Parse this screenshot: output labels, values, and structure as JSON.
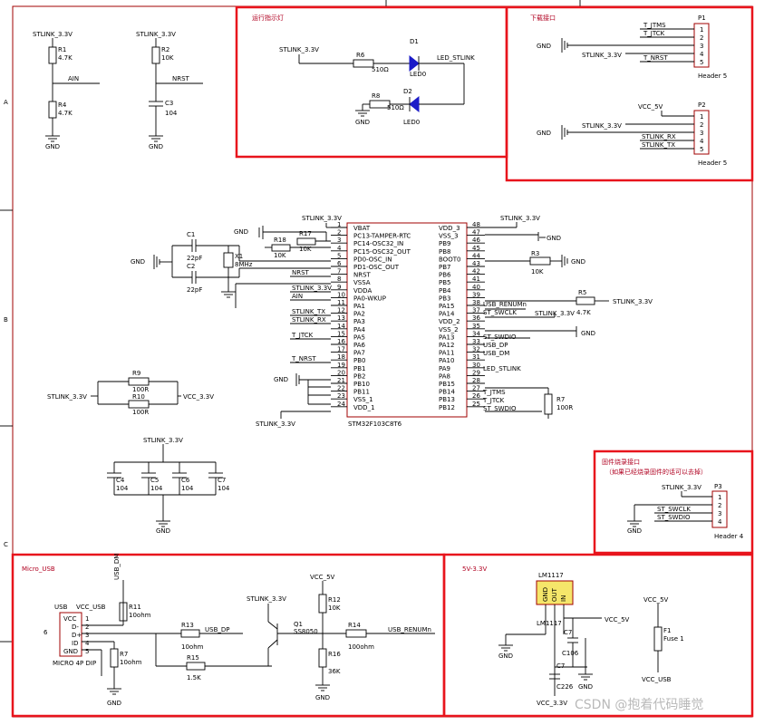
{
  "modules": {
    "led": "运行指示灯",
    "download": "下载接口",
    "firmware": "固件烧录接口",
    "firmware_note": "（如果已经烧录固件的话可以去掉）",
    "usb": "Micro_USB",
    "power": "5V-3.3V"
  },
  "frame": {
    "a": "A",
    "b": "B",
    "c": "C"
  },
  "nets": {
    "stlink33": "STLINK_3.3V",
    "gnd": "GND",
    "ain": "AIN",
    "nrst": "NRST",
    "led_stlink": "LED_STLINK",
    "t_jtms": "T_JTMS",
    "t_jtck": "T_JTCK",
    "t_nrst": "T_NRST",
    "vcc5": "VCC_5V",
    "vcc33": "VCC_3.3V",
    "stlink_rx": "STLINK_RX",
    "stlink_tx": "STLINK_TX",
    "usb_renum": "USB_RENUMn",
    "st_swclk": "ST_SWCLK",
    "st_swdio": "ST_SWDIO",
    "usb_dp": "USB_DP",
    "usb_dm": "USB_DM",
    "vcc_usb": "VCC_USB"
  },
  "parts": {
    "r1": "R1",
    "r1v": "4.7K",
    "r4": "R4",
    "r4v": "4.7K",
    "r2": "R2",
    "r2v": "10K",
    "c3": "C3",
    "c3v": "104",
    "r6": "R6",
    "r6v": "510Ω",
    "d1": "D1",
    "d1v": "LED0",
    "r8": "R8",
    "r8v": "510Ω",
    "d2": "D2",
    "d2v": "LED0",
    "p1": "P1",
    "p1v": "Header 5",
    "p2": "P2",
    "p2v": "Header 5",
    "p3": "P3",
    "p3v": "Header 4",
    "c1": "C1",
    "c1v": "22pF",
    "c2": "C2",
    "c2v": "22pF",
    "x1": "X1",
    "x1v": "8MHz",
    "r18": "R18",
    "r18v": "10K",
    "r17": "R17",
    "r17v": "10K",
    "r3": "R3",
    "r3v": "10K",
    "r5": "R5",
    "r5v": "4.7K",
    "r7": "R7",
    "r7v": "100R",
    "r9": "R9",
    "r9v": "100R",
    "r10": "R10",
    "r10v": "100R",
    "c4": "C4",
    "c5": "C5",
    "c6": "C6",
    "c7": "C7",
    "c104": "104",
    "mcu": "STM32F103C8T6",
    "usb_conn": "USB",
    "usb_foot": "MICRO 4P DIP",
    "r11": "R11",
    "r11v": "10ohm",
    "r13": "R13",
    "r13v": "10ohm",
    "r15": "R15",
    "r15v": "1.5K",
    "r7b": "R7",
    "r7bv": "10ohm",
    "q1": "Q1",
    "q1v": "SS8050",
    "r12": "R12",
    "r12v": "10K",
    "r14": "R14",
    "r14v": "100ohm",
    "r16": "R16",
    "r16v": "36K",
    "u_reg": "LM1117",
    "u_reg2": "LM1117",
    "c7b": "C7",
    "c106": "C106",
    "c7c": "C7",
    "c226": "C226",
    "f1": "F1",
    "f1v": "Fuse 1"
  },
  "mcu_left": [
    {
      "n": "1",
      "s": "VBAT"
    },
    {
      "n": "2",
      "s": "PC13-TAMPER-RTC"
    },
    {
      "n": "3",
      "s": "PC14-OSC32_IN"
    },
    {
      "n": "4",
      "s": "PC15-OSC32_OUT"
    },
    {
      "n": "5",
      "s": "PD0-OSC_IN"
    },
    {
      "n": "6",
      "s": "PD1-OSC_OUT"
    },
    {
      "n": "7",
      "s": "NRST"
    },
    {
      "n": "8",
      "s": "VSSA"
    },
    {
      "n": "9",
      "s": "VDDA"
    },
    {
      "n": "10",
      "s": "PA0-WKUP"
    },
    {
      "n": "11",
      "s": "PA1"
    },
    {
      "n": "12",
      "s": "PA2"
    },
    {
      "n": "13",
      "s": "PA3"
    },
    {
      "n": "14",
      "s": "PA4"
    },
    {
      "n": "15",
      "s": "PA5"
    },
    {
      "n": "16",
      "s": "PA6"
    },
    {
      "n": "17",
      "s": "PA7"
    },
    {
      "n": "18",
      "s": "PB0"
    },
    {
      "n": "19",
      "s": "PB1"
    },
    {
      "n": "20",
      "s": "PB2"
    },
    {
      "n": "21",
      "s": "PB10"
    },
    {
      "n": "22",
      "s": "PB11"
    },
    {
      "n": "23",
      "s": "VSS_1"
    },
    {
      "n": "24",
      "s": "VDD_1"
    }
  ],
  "mcu_right": [
    {
      "n": "48",
      "s": "VDD_3"
    },
    {
      "n": "47",
      "s": "VSS_3"
    },
    {
      "n": "46",
      "s": "PB9"
    },
    {
      "n": "45",
      "s": "PB8"
    },
    {
      "n": "44",
      "s": "BOOT0"
    },
    {
      "n": "43",
      "s": "PB7"
    },
    {
      "n": "42",
      "s": "PB6"
    },
    {
      "n": "41",
      "s": "PB5"
    },
    {
      "n": "40",
      "s": "PB4"
    },
    {
      "n": "39",
      "s": "PB3"
    },
    {
      "n": "38",
      "s": "PA15"
    },
    {
      "n": "37",
      "s": "PA14"
    },
    {
      "n": "36",
      "s": "VDD_2"
    },
    {
      "n": "35",
      "s": "VSS_2"
    },
    {
      "n": "34",
      "s": "PA13"
    },
    {
      "n": "33",
      "s": "PA12"
    },
    {
      "n": "32",
      "s": "PA11"
    },
    {
      "n": "31",
      "s": "PA10"
    },
    {
      "n": "30",
      "s": "PA9"
    },
    {
      "n": "29",
      "s": "PA8"
    },
    {
      "n": "28",
      "s": "PB15"
    },
    {
      "n": "27",
      "s": "PB14"
    },
    {
      "n": "26",
      "s": "PB13"
    },
    {
      "n": "25",
      "s": "PB12"
    }
  ],
  "header_pins": [
    "1",
    "2",
    "3",
    "4",
    "5"
  ],
  "usb_pins": [
    "VCC",
    "D-",
    "D+",
    "ID",
    "GND"
  ],
  "usb_pinnums": [
    "1",
    "2",
    "3",
    "4",
    "5"
  ],
  "reg_pins": [
    "GND",
    "OUT",
    "IN"
  ],
  "watermark": "CSDN @抱着代码睡觉"
}
